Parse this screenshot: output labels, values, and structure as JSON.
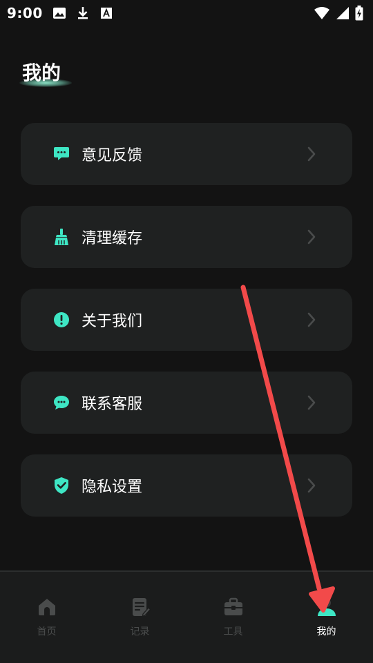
{
  "status_bar": {
    "time": "9:00",
    "icons": [
      "image-icon",
      "download-icon",
      "font-icon",
      "wifi-icon",
      "signal-icon",
      "battery-charging-icon"
    ]
  },
  "page": {
    "title": "我的"
  },
  "menu": {
    "items": [
      {
        "label": "意见反馈",
        "icon": "chat-bubble-icon"
      },
      {
        "label": "清理缓存",
        "icon": "broom-icon"
      },
      {
        "label": "关于我们",
        "icon": "info-icon"
      },
      {
        "label": "联系客服",
        "icon": "customer-service-icon"
      },
      {
        "label": "隐私设置",
        "icon": "shield-check-icon"
      }
    ]
  },
  "bottom_nav": {
    "items": [
      {
        "label": "首页",
        "icon": "home-icon",
        "active": false
      },
      {
        "label": "记录",
        "icon": "record-icon",
        "active": false
      },
      {
        "label": "工具",
        "icon": "toolbox-icon",
        "active": false
      },
      {
        "label": "我的",
        "icon": "profile-icon",
        "active": true
      }
    ]
  },
  "colors": {
    "accent": "#3ee6c4",
    "background": "#131313",
    "card": "#1f2121",
    "annotation_arrow": "#f24a4a"
  }
}
